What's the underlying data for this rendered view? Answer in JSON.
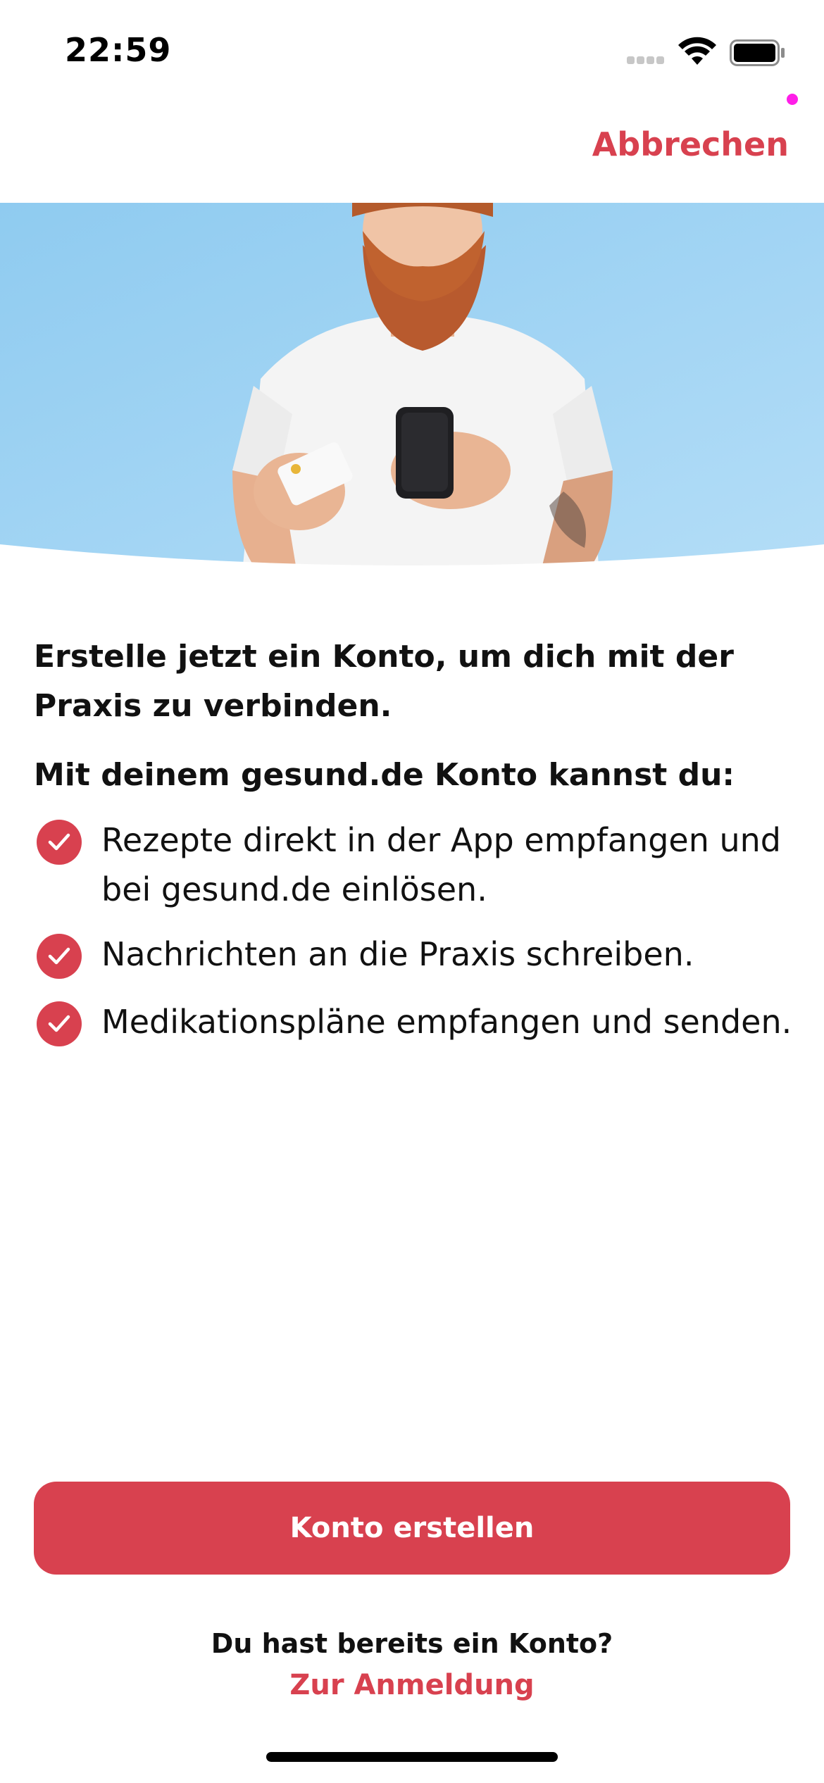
{
  "status_bar": {
    "time": "22:59"
  },
  "header": {
    "cancel_label": "Abbrechen"
  },
  "hero": {
    "background_color": "#a9d8f4"
  },
  "content": {
    "headline": "Erstelle jetzt ein Konto, um dich mit der Praxis zu verbinden.",
    "subheadline": "Mit deinem gesund.de Konto kannst du:",
    "benefits": [
      {
        "text": "Rezepte direkt in der App empfangen und bei gesund.de einlösen."
      },
      {
        "text": "Nachrichten an die Praxis schreiben."
      },
      {
        "text": "Medikationspläne empfangen und senden."
      }
    ]
  },
  "actions": {
    "primary_label": "Konto erstellen",
    "existing_account_text": "Du hast bereits ein Konto?",
    "login_label": "Zur Anmeldung"
  },
  "colors": {
    "accent": "#d8414f",
    "text": "#111111",
    "background": "#ffffff"
  }
}
